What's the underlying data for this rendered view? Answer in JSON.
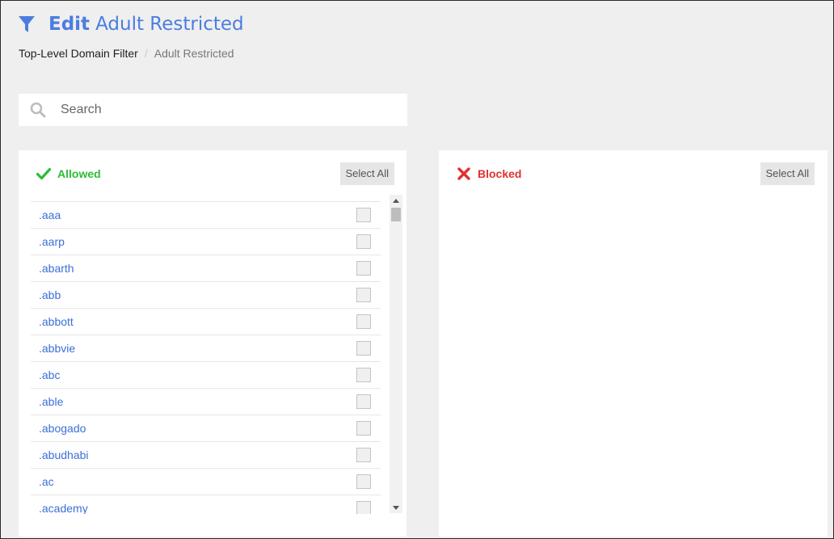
{
  "header": {
    "icon": "filter-icon",
    "title_edit": "Edit",
    "title_name": "Adult Restricted",
    "accent_color": "#4b7de0"
  },
  "breadcrumb": {
    "link": "Top-Level Domain Filter",
    "separator": "/",
    "current": "Adult Restricted"
  },
  "search": {
    "icon": "search-icon",
    "placeholder": "Search",
    "value": ""
  },
  "allowed": {
    "icon": "check-icon",
    "label": "Allowed",
    "color": "#2cbd36",
    "select_all_label": "Select All",
    "items": [
      {
        "tld": ".aaa"
      },
      {
        "tld": ".aarp"
      },
      {
        "tld": ".abarth"
      },
      {
        "tld": ".abb"
      },
      {
        "tld": ".abbott"
      },
      {
        "tld": ".abbvie"
      },
      {
        "tld": ".abc"
      },
      {
        "tld": ".able"
      },
      {
        "tld": ".abogado"
      },
      {
        "tld": ".abudhabi"
      },
      {
        "tld": ".ac"
      },
      {
        "tld": ".academy"
      }
    ]
  },
  "blocked": {
    "icon": "x-icon",
    "label": "Blocked",
    "color": "#e23030",
    "select_all_label": "Select All",
    "items": []
  }
}
